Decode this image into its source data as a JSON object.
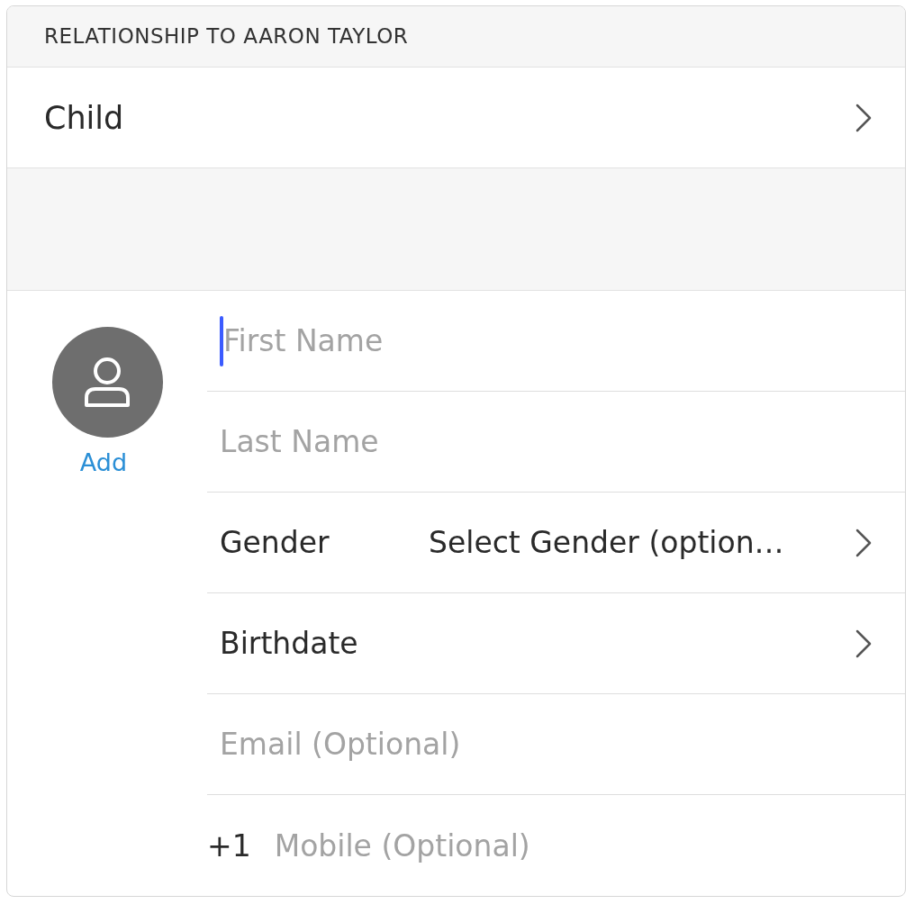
{
  "section_header": "RELATIONSHIP TO AARON TAYLOR",
  "relationship": {
    "value": "Child"
  },
  "avatar": {
    "action": "Add"
  },
  "fields": [
    {
      "kind": "input",
      "placeholder": "First Name",
      "focused": true
    },
    {
      "kind": "input",
      "placeholder": "Last Name",
      "focused": false
    },
    {
      "kind": "select",
      "label": "Gender",
      "value": "Select Gender (option…"
    },
    {
      "kind": "select",
      "label": "Birthdate"
    },
    {
      "kind": "input",
      "placeholder": "Email (Optional)",
      "focused": false
    },
    {
      "kind": "phone",
      "prefix": "+1",
      "placeholder": "Mobile (Optional)"
    }
  ]
}
